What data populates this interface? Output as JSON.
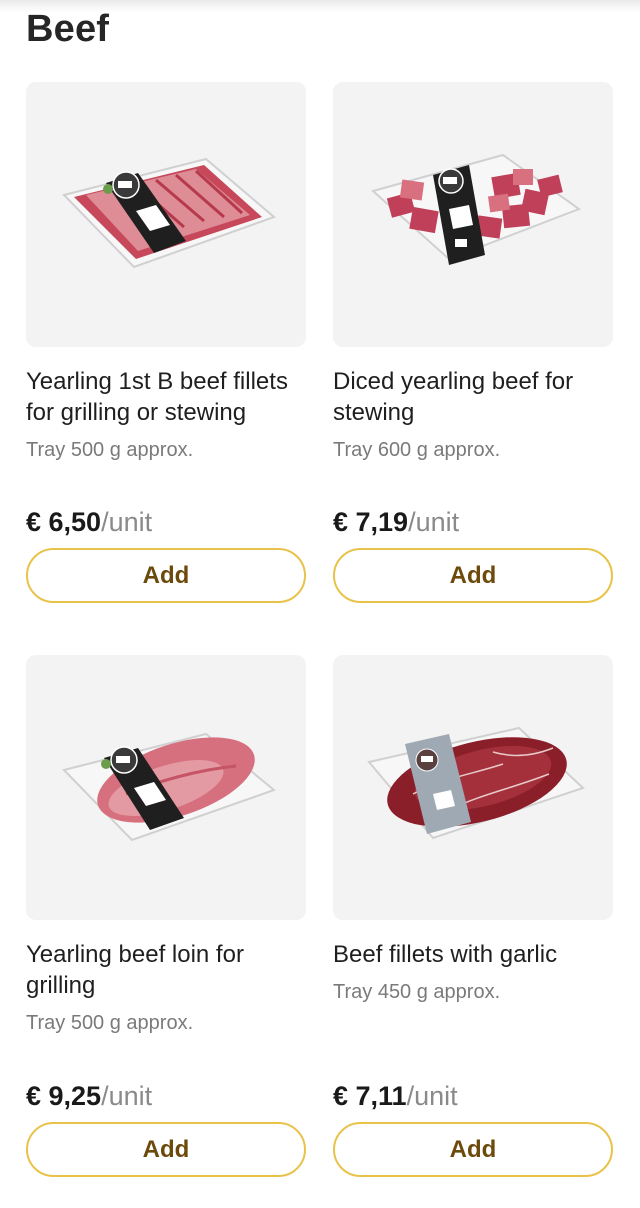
{
  "section": {
    "title": "Beef"
  },
  "products": [
    {
      "name": "Yearling 1st B beef fillets for grilling or stewing",
      "subtitle": "Tray 500 g approx.",
      "price": "€ 6,50",
      "unit": "/unit",
      "button": "Add",
      "image": "beef-fillets-tray-image"
    },
    {
      "name": "Diced yearling beef for stewing",
      "subtitle": "Tray 600 g approx.",
      "price": "€ 7,19",
      "unit": "/unit",
      "button": "Add",
      "image": "diced-beef-tray-image"
    },
    {
      "name": "Yearling beef loin for grilling",
      "subtitle": "Tray 500 g approx.",
      "price": "€ 9,25",
      "unit": "/unit",
      "button": "Add",
      "image": "beef-loin-tray-image"
    },
    {
      "name": "Beef fillets with garlic",
      "subtitle": "Tray 450 g approx.",
      "price": "€ 7,11",
      "unit": "/unit",
      "button": "Add",
      "image": "garlic-beef-fillets-tray-image"
    }
  ],
  "colors": {
    "button_border": "#e9c24a",
    "button_text": "#6b4a0c",
    "card_bg": "#f3f3f3"
  }
}
